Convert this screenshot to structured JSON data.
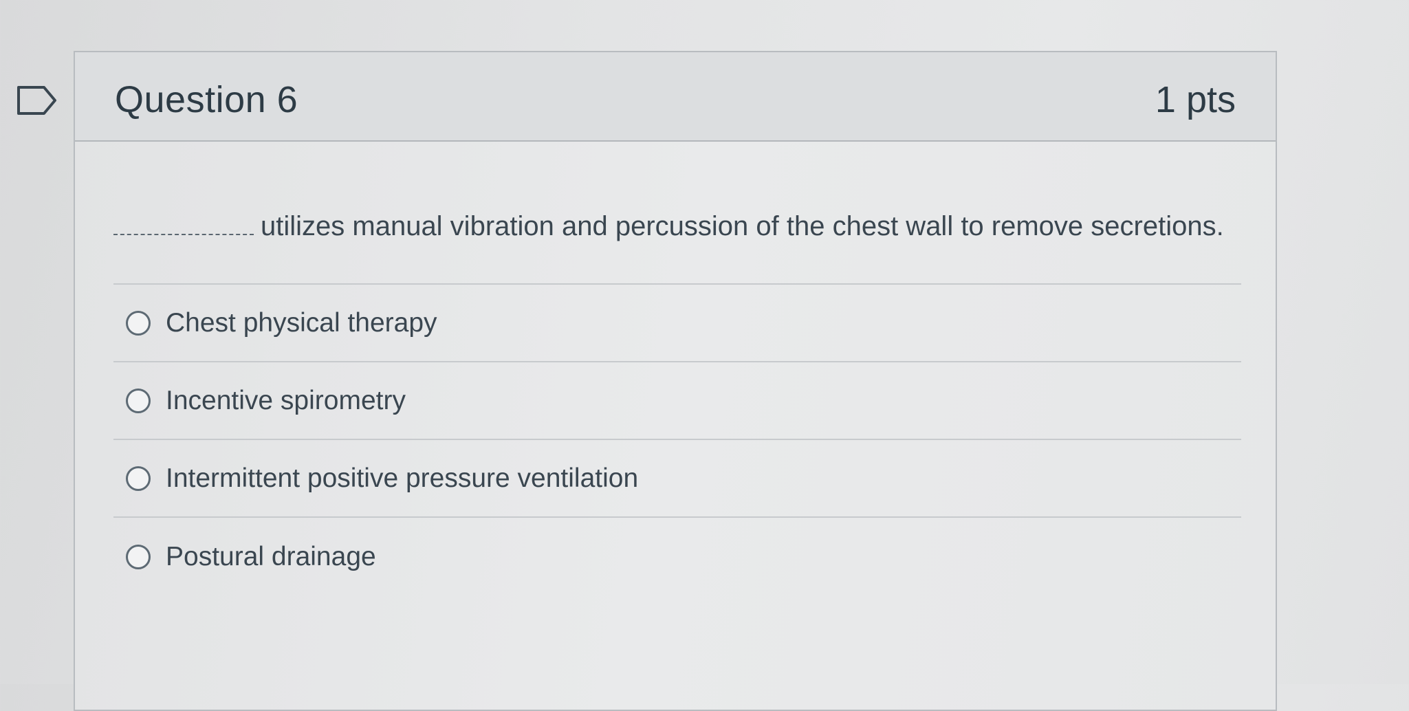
{
  "question": {
    "title": "Question 6",
    "points": "1 pts",
    "blank": "__________",
    "text": "utilizes manual vibration and percussion of the chest wall to remove secretions.",
    "flag_icon": "bookmark-flag-icon"
  },
  "answers": [
    {
      "label": "Chest physical therapy"
    },
    {
      "label": "Incentive spirometry"
    },
    {
      "label": "Intermittent positive pressure ventilation"
    },
    {
      "label": "Postural drainage"
    }
  ]
}
